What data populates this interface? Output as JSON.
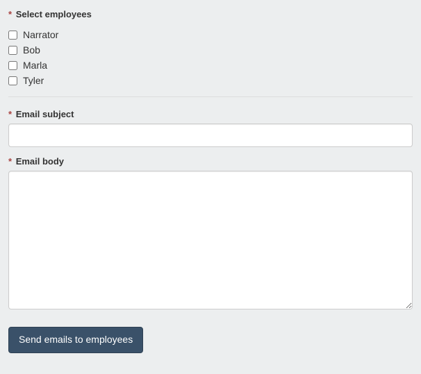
{
  "employees": {
    "label": "Select employees",
    "items": [
      {
        "name": "Narrator",
        "checked": false
      },
      {
        "name": "Bob",
        "checked": false
      },
      {
        "name": "Marla",
        "checked": false
      },
      {
        "name": "Tyler",
        "checked": false
      }
    ]
  },
  "subject": {
    "label": "Email subject",
    "value": ""
  },
  "body": {
    "label": "Email body",
    "value": ""
  },
  "submit": {
    "label": "Send emails to employees"
  }
}
